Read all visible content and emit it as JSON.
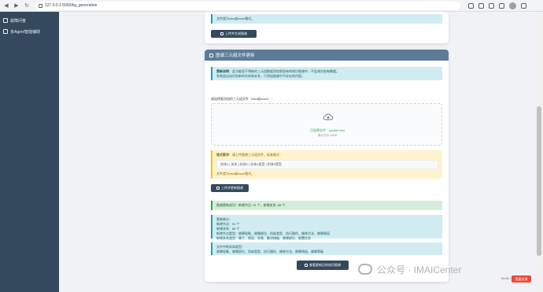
{
  "browser": {
    "url": "127.0.0.1:5000/kg_generation"
  },
  "sidebar": {
    "items": [
      {
        "label": "故障问答"
      },
      {
        "label": "多Agent智能辅助"
      }
    ]
  },
  "card1": {
    "info_text": "文件类为xlsx或excel格式。",
    "button_label": "上传并生成图谱"
  },
  "card2": {
    "title": "图谱三元组文件更新",
    "info_title": "更新说明：",
    "info_text1": "此功能用于将新的三元组数据添加到现有的知识图谱中，不会清空现有数据。",
    "info_text2": "系统会自动识别新的实体和关系，只添加图谱中不存在的内容。",
    "upload_label": "请选择要添加的三元组文件（xlsx或excel）：",
    "upload_link": "已选择文件：update.xlsx",
    "upload_hint": "最大支持 16MB",
    "warn_title": "格式要求：",
    "warn_text": "请上传图谱三元组文件，标准格式：",
    "warn_code": "实体1 | 关系 | 实体2 | 实体1类型 | 实体2类型",
    "warn_foot": "文件类为xlsx或excel格式。",
    "button_label": "上传并更新图谱",
    "result_success": "图谱更新成功！新增节点: 91 个，新增关系: 88 个",
    "detail_title": "更新统计：",
    "detail_line1": "新增节点：91 个",
    "detail_line2": "新增关系：88 个",
    "detail_line3": "新增节点类型：故障现象、故障部位、机床类型、执行操作、维修方法、故障原因",
    "detail_line4": "新增关系类型：属于、原因、导致、解决措施、故障部位、前置任务",
    "type_title": "文件中的实体类型：",
    "type_line": "故障现象、故障部位、机床类型、执行操作、维修方法、故障原因、故障等级",
    "view_button": "查看更新后的知识图谱"
  },
  "watermark": {
    "text": "公众号 · IMAICenter"
  },
  "media": {
    "time": "00:41 / 28:00",
    "red_button": "我要反馈"
  },
  "colors": {
    "sidebar_bg": "#34495e",
    "header_bg": "#5d7b99",
    "info_bg": "#d1ecf1",
    "warn_bg": "#fff3cd",
    "success_bg": "#d4edda"
  }
}
